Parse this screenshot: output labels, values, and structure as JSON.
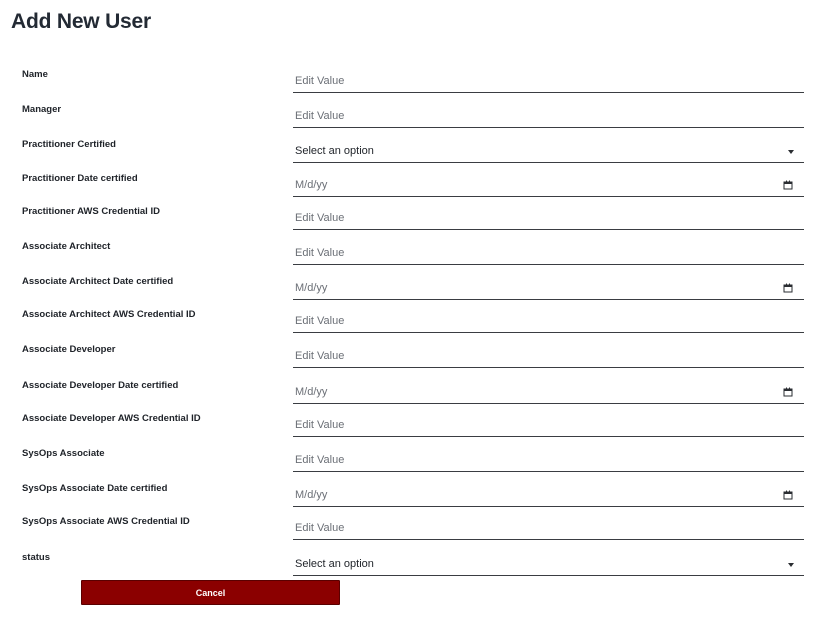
{
  "page": {
    "title": "Add New User"
  },
  "fields": [
    {
      "label": "Name",
      "type": "text",
      "placeholder": "Edit Value"
    },
    {
      "label": "Manager",
      "type": "text",
      "placeholder": "Edit Value"
    },
    {
      "label": "Practitioner Certified",
      "type": "select",
      "value": "Select an option",
      "icon": "caret-down-icon"
    },
    {
      "label": "Practitioner Date certified",
      "type": "date",
      "placeholder": "M/d/yy",
      "icon": "calendar-icon"
    },
    {
      "label": "Practitioner AWS Credential ID",
      "type": "text",
      "placeholder": "Edit Value"
    },
    {
      "label": "Associate Architect",
      "type": "text",
      "placeholder": "Edit Value"
    },
    {
      "label": "Associate Architect Date certified",
      "type": "date",
      "placeholder": "M/d/yy",
      "icon": "calendar-icon"
    },
    {
      "label": "Associate Architect AWS Credential ID",
      "type": "text",
      "placeholder": "Edit Value"
    },
    {
      "label": "Associate Developer",
      "type": "text",
      "placeholder": "Edit Value"
    },
    {
      "label": "Associate Developer Date certified",
      "type": "date",
      "placeholder": "M/d/yy",
      "icon": "calendar-icon"
    },
    {
      "label": "Associate Developer AWS Credential ID",
      "type": "text",
      "placeholder": "Edit Value"
    },
    {
      "label": "SysOps Associate",
      "type": "text",
      "placeholder": "Edit Value"
    },
    {
      "label": "SysOps Associate Date certified",
      "type": "date",
      "placeholder": "M/d/yy",
      "icon": "calendar-icon"
    },
    {
      "label": "SysOps Associate AWS Credential ID",
      "type": "text",
      "placeholder": "Edit Value"
    },
    {
      "label": "status",
      "type": "select",
      "value": "Select an option",
      "icon": "caret-down-icon"
    }
  ],
  "actions": {
    "cancel_label": "Cancel"
  },
  "colors": {
    "cancel_button_bg": "#8b0000",
    "title_text": "#232a34",
    "field_underline": "#3a3d42",
    "placeholder_text": "#6b6f76"
  }
}
